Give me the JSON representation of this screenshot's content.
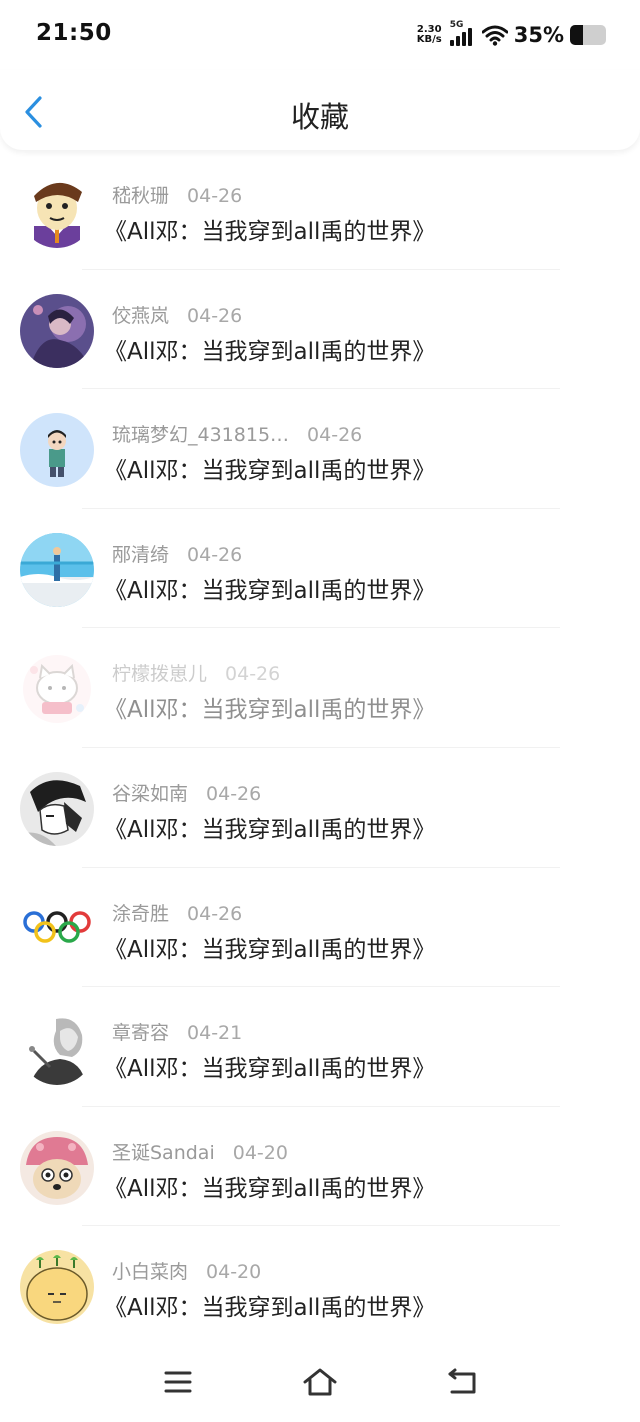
{
  "status": {
    "time": "21:50",
    "net_speed_value": "2.30",
    "net_speed_unit": "KB/s",
    "network": "5G",
    "battery_text": "35%",
    "battery_level": 0.35
  },
  "header": {
    "title": "收藏",
    "back_icon": "chevron-left-icon"
  },
  "items": [
    {
      "author": "嵇秋珊",
      "date": "04-26",
      "title": "《All邓：当我穿到all禹的世界》",
      "avatar": "cartoon-man"
    },
    {
      "author": "佼燕岚",
      "date": "04-26",
      "title": "《All邓：当我穿到all禹的世界》",
      "avatar": "purple-painting"
    },
    {
      "author": "琉璃梦幻_431815…",
      "date": "04-26",
      "title": "《All邓：当我穿到all禹的世界》",
      "avatar": "boy-figure"
    },
    {
      "author": "邴清绮",
      "date": "04-26",
      "title": "《All邓：当我穿到all禹的世界》",
      "avatar": "beach-scene"
    },
    {
      "author": "柠檬拨崽儿",
      "date": "04-26",
      "title": "《All邓：当我穿到all禹的世界》",
      "avatar": "cat-cartoon",
      "faded": true
    },
    {
      "author": "谷梁如南",
      "date": "04-26",
      "title": "《All邓：当我穿到all禹的世界》",
      "avatar": "manga-sketch"
    },
    {
      "author": "涂奇胜",
      "date": "04-26",
      "title": "《All邓：当我穿到all禹的世界》",
      "avatar": "olympic-rings"
    },
    {
      "author": "章寄容",
      "date": "04-21",
      "title": "《All邓：当我穿到all禹的世界》",
      "avatar": "bw-portrait"
    },
    {
      "author": "圣诞Sandai",
      "date": "04-20",
      "title": "《All邓：当我穿到all禹的世界》",
      "avatar": "pink-hat-dog"
    },
    {
      "author": "小白菜肉",
      "date": "04-20",
      "title": "《All邓：当我穿到all禹的世界》",
      "avatar": "yellow-sprout"
    }
  ],
  "nav": {
    "menu_icon": "menu-icon",
    "home_icon": "home-icon",
    "back_icon": "back-return-icon"
  },
  "colors": {
    "accent": "#2b8fe0",
    "text": "#222222",
    "meta": "#9a9a9a"
  }
}
